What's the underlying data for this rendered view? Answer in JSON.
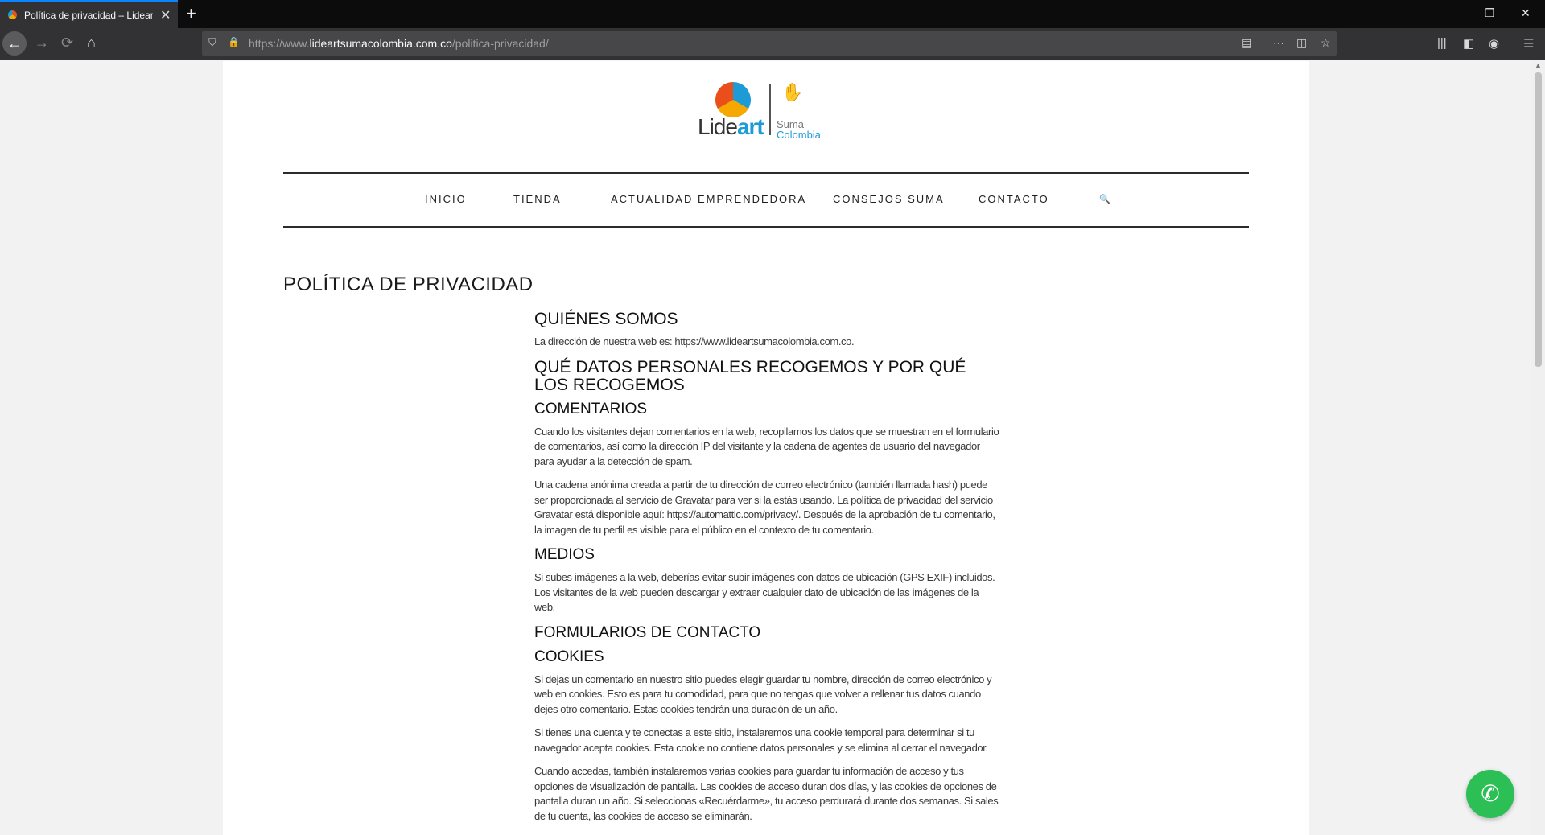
{
  "browser": {
    "tab_title": "Política de privacidad – Lideart",
    "tab_close": "✕",
    "new_tab": "+",
    "url_scheme": "https://www.",
    "url_domain": "lideartsumacolombia.com.co",
    "url_path": "/politica-privacidad/",
    "window": {
      "minimize": "—",
      "restore": "❐",
      "close": "✕"
    }
  },
  "logo": {
    "brand_a": "Lide",
    "brand_b": "art",
    "tag_a": "Suma",
    "tag_b": "Colombia"
  },
  "menu": {
    "items": [
      "INICIO",
      "TIENDA",
      "ACTUALIDAD EMPRENDEDORA",
      "CONSEJOS SUMA",
      "CONTACTO"
    ],
    "search": "🔍"
  },
  "page_title": "POLÍTICA DE PRIVACIDAD",
  "sections": {
    "quienes_h": "QUIÉNES SOMOS",
    "quienes_p": "La dirección de nuestra web es: https://www.lideartsumacolombia.com.co.",
    "datos_h": "QUÉ DATOS PERSONALES RECOGEMOS Y POR QUÉ LOS RECOGEMOS",
    "comentarios_h": "COMENTARIOS",
    "comentarios_p1": "Cuando los visitantes dejan comentarios en la web, recopilamos los datos que se muestran en el formulario de comentarios, así como la dirección IP del visitante y la cadena de agentes de usuario del navegador para ayudar a la detección de spam.",
    "comentarios_p2": "Una cadena anónima creada a partir de tu dirección de correo electrónico (también llamada hash) puede ser proporcionada al servicio de Gravatar para ver si la estás usando. La política de privacidad del servicio Gravatar está disponible aquí: https://automattic.com/privacy/. Después de la aprobación de tu comentario, la imagen de tu perfil es visible para el público en el contexto de tu comentario.",
    "medios_h": "MEDIOS",
    "medios_p": "Si subes imágenes a la web, deberías evitar subir imágenes con datos de ubicación (GPS EXIF) incluidos. Los visitantes de la web pueden descargar y extraer cualquier dato de ubicación de las imágenes de la web.",
    "formularios_h": "FORMULARIOS DE CONTACTO",
    "cookies_h": "COOKIES",
    "cookies_p1": "Si dejas un comentario en nuestro sitio puedes elegir guardar tu nombre, dirección de correo electrónico y web en cookies. Esto es para tu comodidad, para que no tengas que volver a rellenar tus datos cuando dejes otro comentario. Estas cookies tendrán una duración de un año.",
    "cookies_p2": "Si tienes una cuenta y te conectas a este sitio, instalaremos una cookie temporal para determinar si tu navegador acepta cookies. Esta cookie no contiene datos personales y se elimina al cerrar el navegador.",
    "cookies_p3": "Cuando accedas, también instalaremos varias cookies para guardar tu información de acceso y tus opciones de visualización de pantalla. Las cookies de acceso duran dos días, y las cookies de opciones de pantalla duran un año. Si seleccionas «Recuérdarme», tu acceso perdurará durante dos semanas. Si sales de tu cuenta, las cookies de acceso se eliminarán."
  },
  "colors": {
    "accent_blue": "#1d9bd7",
    "whatsapp_green": "#2bbf55",
    "tab_highlight": "#0a84ff"
  }
}
